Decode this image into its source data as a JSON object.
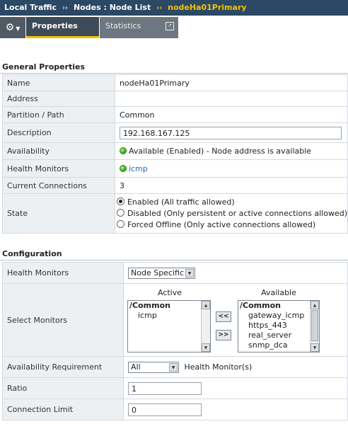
{
  "breadcrumb": {
    "part1": "Local Traffic",
    "sep1": "››",
    "part2": "Nodes : Node List",
    "sep2": "››",
    "part3": "nodeHa01Primary"
  },
  "tabs": {
    "properties": "Properties",
    "statistics": "Statistics"
  },
  "general": {
    "title": "General Properties",
    "rows": {
      "name_label": "Name",
      "name_value": "nodeHa01Primary",
      "address_label": "Address",
      "address_value": "",
      "partition_label": "Partition / Path",
      "partition_value": "Common",
      "description_label": "Description",
      "description_value": "192.168.167.125",
      "availability_label": "Availability",
      "availability_value": "Available (Enabled) - Node address is available",
      "health_label": "Health Monitors",
      "health_value": "icmp",
      "connections_label": "Current Connections",
      "connections_value": "3",
      "state_label": "State",
      "state_options": [
        "Enabled (All traffic allowed)",
        "Disabled (Only persistent or active connections allowed)",
        "Forced Offline (Only active connections allowed)"
      ],
      "state_selected": 0
    }
  },
  "configuration": {
    "title": "Configuration",
    "health_label": "Health Monitors",
    "health_select": "Node Specific",
    "select_monitors_label": "Select Monitors",
    "active_header": "Active",
    "available_header": "Available",
    "active_items": [
      "/Common",
      "icmp"
    ],
    "available_items": [
      "/Common",
      "gateway_icmp",
      "https_443",
      "real_server",
      "snmp_dca"
    ],
    "move_left": "<<",
    "move_right": ">>",
    "avail_req_label": "Availability Requirement",
    "avail_req_select": "All",
    "avail_req_suffix": "Health Monitor(s)",
    "ratio_label": "Ratio",
    "ratio_value": "1",
    "conn_limit_label": "Connection Limit",
    "conn_limit_value": "0"
  },
  "icons": {
    "gear": "gear-icon",
    "popout": "popout-icon",
    "status": "green-status-dot-icon"
  },
  "colors": {
    "topbar": "#2b4864",
    "accent": "#f2c300",
    "link": "#2a63b7",
    "status_green": "#2da11b"
  }
}
